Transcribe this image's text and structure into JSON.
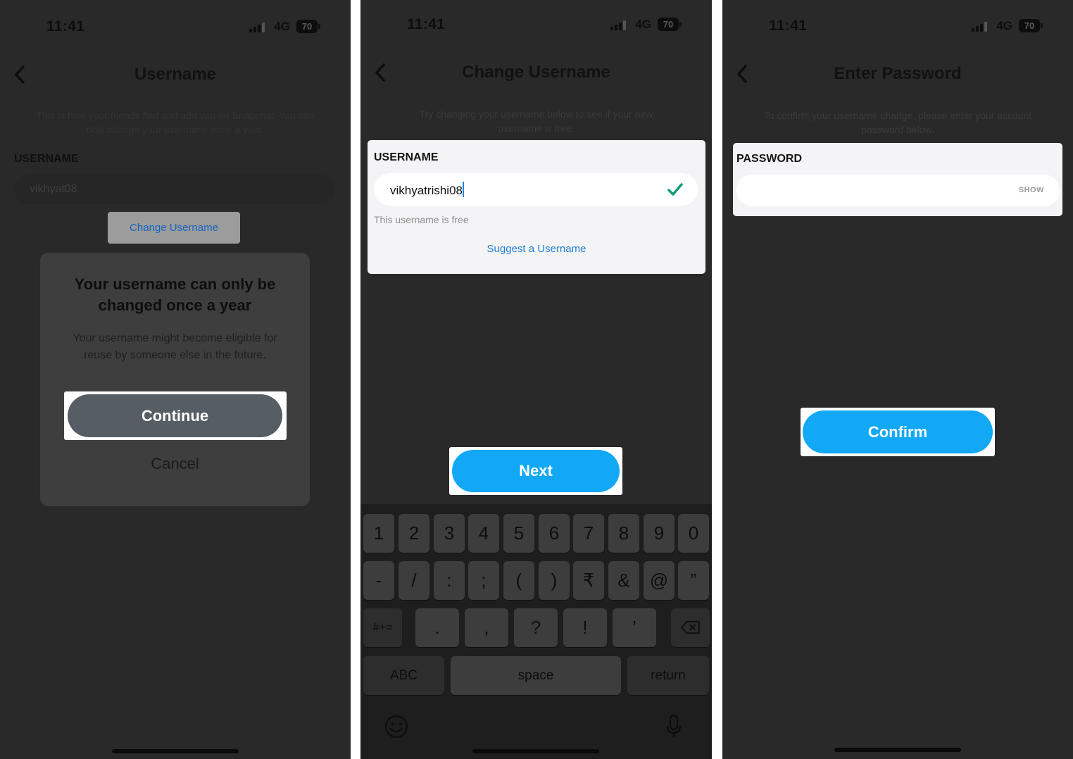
{
  "status": {
    "time": "11:41",
    "network": "4G",
    "battery": "70"
  },
  "panel1": {
    "title": "Username",
    "description": "This is how your friends find and add you on Snapchat. You can only change your username once a year.",
    "section_label": "USERNAME",
    "username_value": "vikhyat08",
    "change_button": "Change Username",
    "dialog": {
      "title": "Your username can only be changed once a year",
      "body": "Your username might become eligible for reuse by someone else in the future.",
      "continue_label": "Continue",
      "cancel_label": "Cancel"
    }
  },
  "panel2": {
    "title": "Change Username",
    "description": "Try changing your username below to see if your new username is free.",
    "section_label": "USERNAME",
    "username_value": "vikhyatrishi08",
    "availability": "This username is free",
    "suggest_link": "Suggest a Username",
    "next_label": "Next",
    "keyboard": {
      "row1": [
        "1",
        "2",
        "3",
        "4",
        "5",
        "6",
        "7",
        "8",
        "9",
        "0"
      ],
      "row2": [
        "-",
        "/",
        ":",
        ";",
        "(",
        ")",
        "₹",
        "&",
        "@",
        "”"
      ],
      "row3_switch": "#+=",
      "row3": [
        ".",
        ",",
        "?",
        "!",
        "’"
      ],
      "abc": "ABC",
      "space": "space",
      "return": "return"
    }
  },
  "panel3": {
    "title": "Enter Password",
    "description": "To confirm your username change, please enter your account password below.",
    "section_label": "PASSWORD",
    "show_label": "SHOW",
    "confirm_label": "Confirm"
  },
  "colors": {
    "accent_blue": "#12a8f5",
    "check_green": "#0f9d7a",
    "link_blue": "#1e7fd6"
  }
}
